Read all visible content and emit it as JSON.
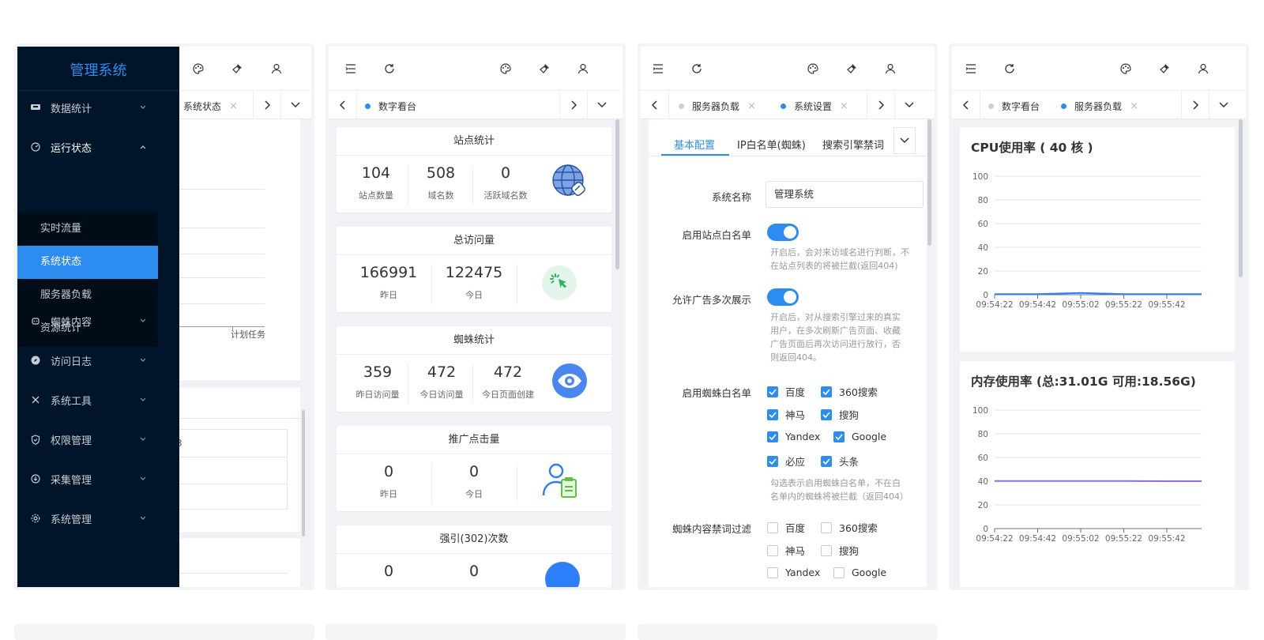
{
  "phone1": {
    "logo": "管理系统",
    "tab_label": "系统状态",
    "tab_close": "×",
    "menu": [
      {
        "label": "数据统计",
        "icon": "chart-icon"
      },
      {
        "label": "运行状态",
        "icon": "dashboard-icon"
      },
      {
        "label": "蜘蛛内容",
        "icon": "spider-icon"
      },
      {
        "label": "访问日志",
        "icon": "compass-icon"
      },
      {
        "label": "系统工具",
        "icon": "tools-icon"
      },
      {
        "label": "权限管理",
        "icon": "shield-icon"
      },
      {
        "label": "采集管理",
        "icon": "download-icon"
      },
      {
        "label": "系统管理",
        "icon": "gear-icon"
      }
    ],
    "submenu": [
      "实时流量",
      "系统状态",
      "服务器负载",
      "资源统计"
    ],
    "bg_axis_label": "计划任务",
    "bg_partial_text": "3"
  },
  "phone2": {
    "tabs": [
      {
        "label": "数字看台"
      }
    ],
    "cards": [
      {
        "title": "站点统计",
        "cells": [
          {
            "num": "104",
            "lbl": "站点数量"
          },
          {
            "num": "508",
            "lbl": "域名数"
          },
          {
            "num": "0",
            "lbl": "活跃域名数"
          }
        ],
        "icon": "globe-link-icon"
      },
      {
        "title": "总访问量",
        "cells": [
          {
            "num": "166991",
            "lbl": "昨日"
          },
          {
            "num": "122475",
            "lbl": "今日"
          }
        ],
        "icon": "click-icon"
      },
      {
        "title": "蜘蛛统计",
        "cells": [
          {
            "num": "359",
            "lbl": "昨日访问量"
          },
          {
            "num": "472",
            "lbl": "今日访问量"
          },
          {
            "num": "472",
            "lbl": "今日页面创建"
          }
        ],
        "icon": "eye-icon"
      },
      {
        "title": "推广点击量",
        "cells": [
          {
            "num": "0",
            "lbl": "昨日"
          },
          {
            "num": "0",
            "lbl": "今日"
          }
        ],
        "icon": "user-clipboard-icon"
      },
      {
        "title": "强引(302)次数",
        "cells": [
          {
            "num": "0",
            "lbl": ""
          },
          {
            "num": "0",
            "lbl": ""
          }
        ],
        "icon": "blue-circle-icon"
      }
    ]
  },
  "phone3": {
    "tabs": [
      {
        "label": "服务器负载",
        "close": "×"
      },
      {
        "label": "系统设置",
        "close": "×"
      }
    ],
    "form_tabs": [
      "基本配置",
      "IP白名单(蜘蛛)",
      "搜索引擎禁词"
    ],
    "fields": {
      "name_label": "系统名称",
      "name_value": "管理系统",
      "whitelist_label": "启用站点白名单",
      "whitelist_help": "开启后，会对来访域名进行判断，不在站点列表的将被拦截(返回404)",
      "ads_label": "允许广告多次展示",
      "ads_help": "开启后，对从搜索引擎过来的真实用户，在多次刷新广告页面、收藏广告页面后再次访问进行放行，否则返回404。",
      "spider_label": "启用蜘蛛白名单",
      "spider_options": [
        "百度",
        "360搜索",
        "神马",
        "搜狗",
        "Yandex",
        "Google",
        "必应",
        "头条"
      ],
      "spider_help": "勾选表示启用蜘蛛白名单，不在白名单内的蜘蛛将被拦截（返回404）",
      "filter_label": "蜘蛛内容禁词过滤",
      "filter_options": [
        "百度",
        "360搜索",
        "神马",
        "搜狗",
        "Yandex",
        "Google"
      ]
    }
  },
  "phone4": {
    "tabs": [
      {
        "label": "数字看台"
      },
      {
        "label": "服务器负载",
        "close": "×"
      }
    ],
    "cpu_title": "CPU使用率 ( 40 核 )",
    "mem_title": "内存使用率 (总:31.01G 可用:18.56G)",
    "colors": {
      "cpu": "#2d7ff9",
      "mem": "#8e6be0",
      "accent": "#2d8cf0",
      "sidebar": "#001529"
    }
  },
  "chart_data": [
    {
      "type": "line",
      "title": "CPU使用率 ( 40 核 )",
      "x": [
        "09:54:22",
        "09:54:42",
        "09:55:02",
        "09:55:22",
        "09:55:42"
      ],
      "series": [
        {
          "values": [
            0.5,
            0.5,
            1.5,
            0.5,
            0.5
          ]
        }
      ],
      "ylim": [
        0,
        100
      ],
      "yticks": [
        0,
        20,
        40,
        60,
        80,
        100
      ]
    },
    {
      "type": "line",
      "title": "内存使用率 (总:31.01G 可用:18.56G)",
      "x": [
        "09:54:22",
        "09:54:42",
        "09:55:02",
        "09:55:22",
        "09:55:42"
      ],
      "series": [
        {
          "values": [
            40.2,
            40.2,
            40.2,
            40.2,
            40.0
          ]
        }
      ],
      "ylim": [
        0,
        100
      ],
      "yticks": [
        0,
        20,
        40,
        60,
        80,
        100
      ]
    }
  ]
}
